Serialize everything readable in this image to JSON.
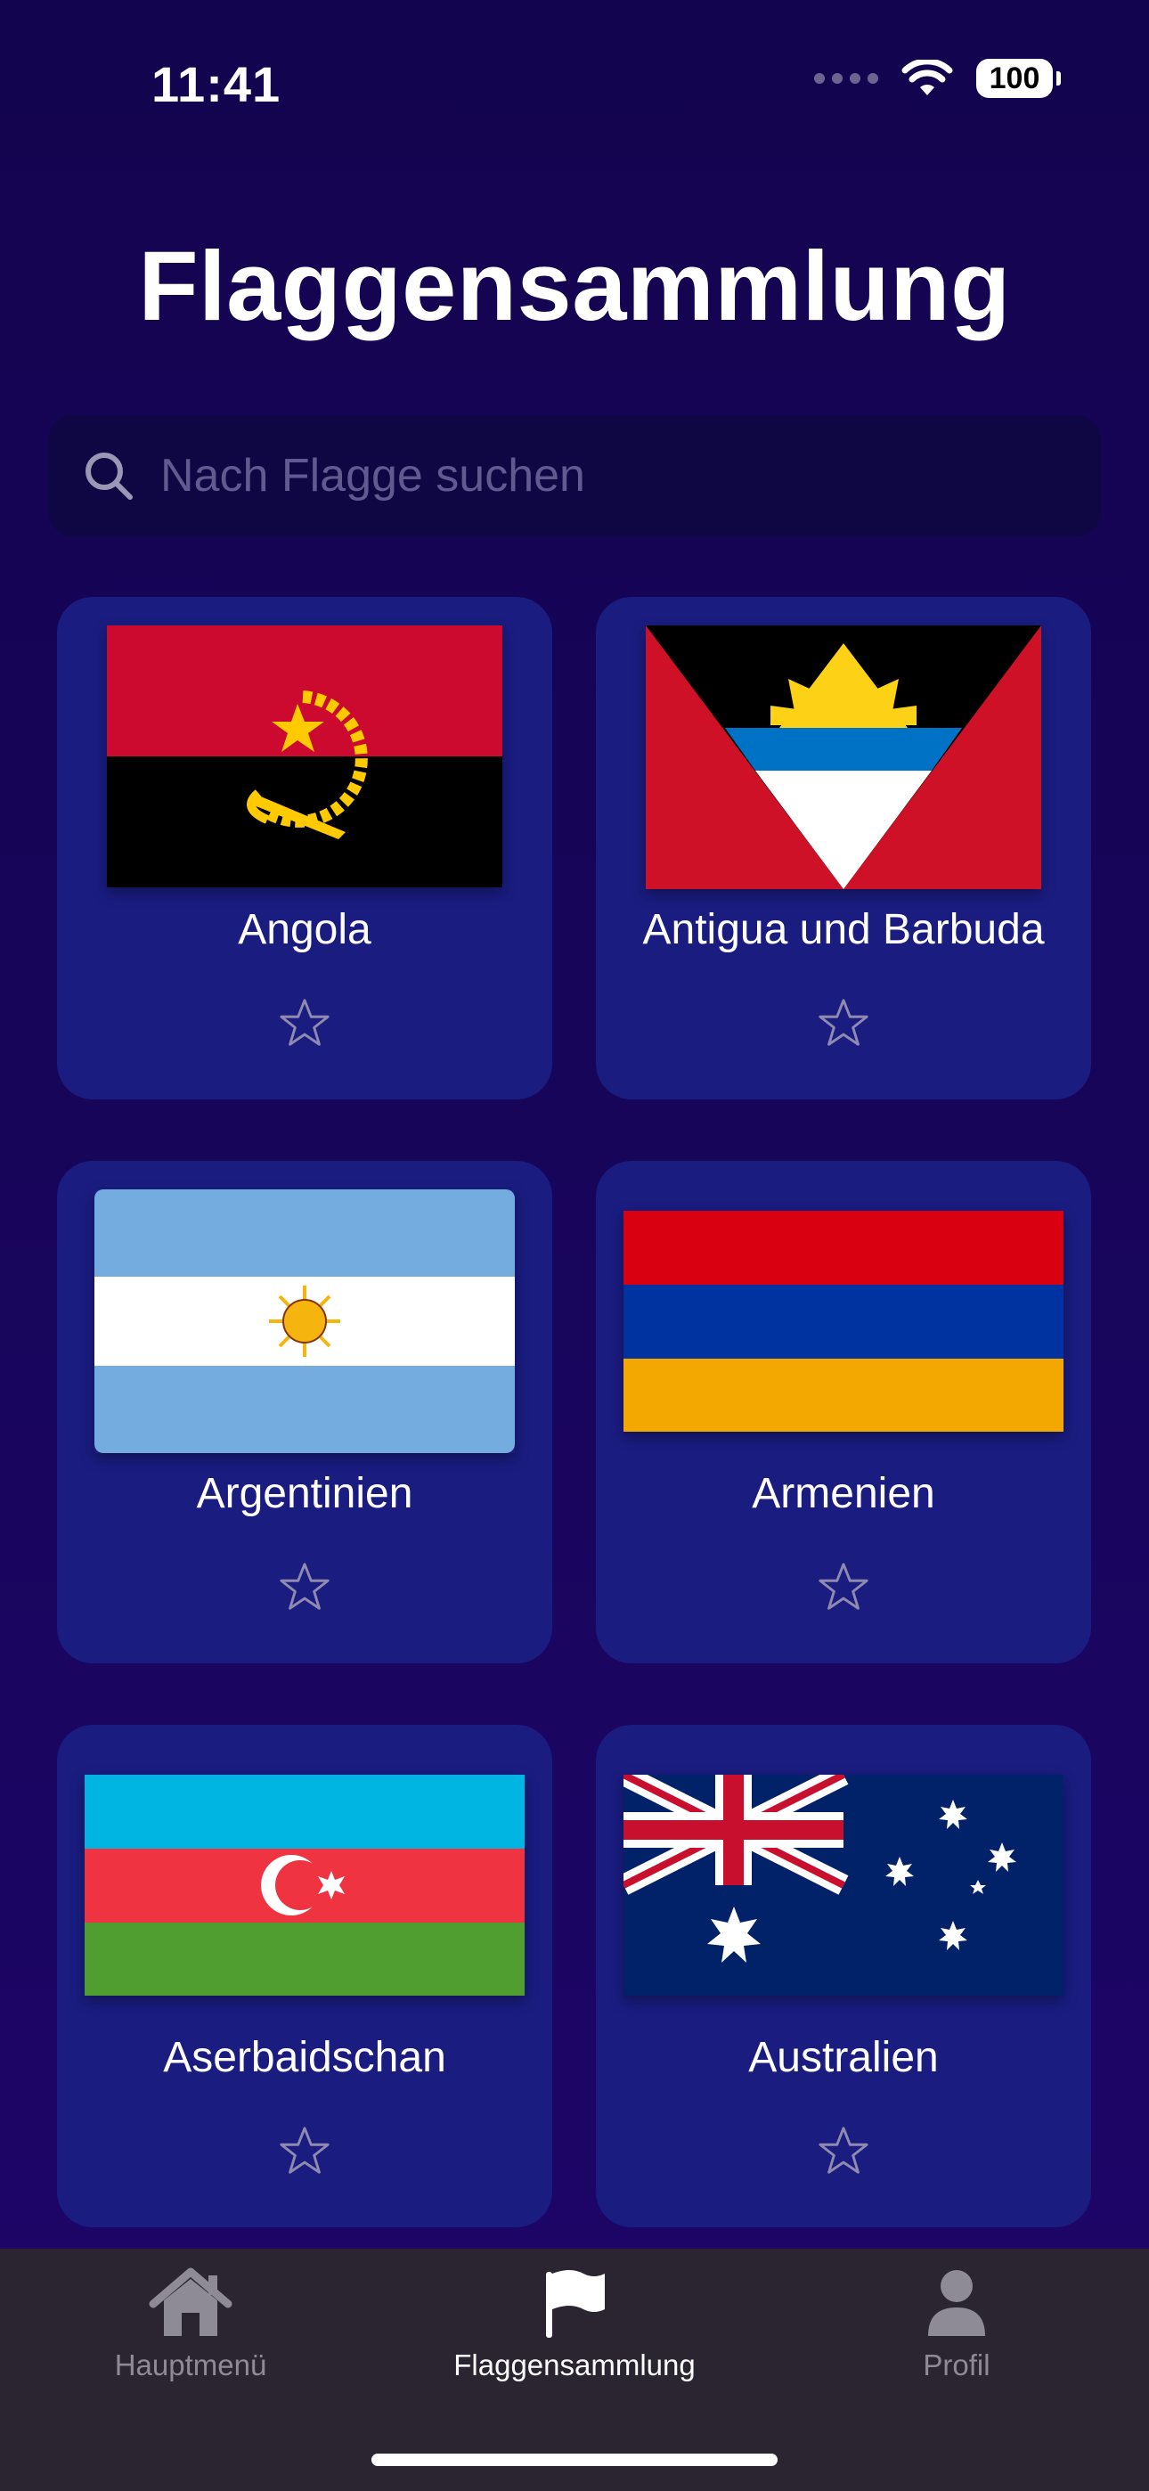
{
  "status_bar": {
    "time": "11:41",
    "battery": "100"
  },
  "header": {
    "title": "Flaggensammlung"
  },
  "search": {
    "placeholder": "Nach Flagge suchen",
    "value": ""
  },
  "flags": [
    {
      "name": "Angola",
      "favorite": false,
      "flag_icon": "flag-angola"
    },
    {
      "name": "Antigua und Barbuda",
      "favorite": false,
      "flag_icon": "flag-antigua-barbuda"
    },
    {
      "name": "Argentinien",
      "favorite": false,
      "flag_icon": "flag-argentina"
    },
    {
      "name": "Armenien",
      "favorite": false,
      "flag_icon": "flag-armenia"
    },
    {
      "name": "Aserbaidschan",
      "favorite": false,
      "flag_icon": "flag-azerbaijan"
    },
    {
      "name": "Australien",
      "favorite": false,
      "flag_icon": "flag-australia"
    }
  ],
  "tabbar": {
    "tabs": [
      {
        "label": "Hauptmenü",
        "icon": "house-icon",
        "active": false
      },
      {
        "label": "Flaggensammlung",
        "icon": "flag-icon",
        "active": true
      },
      {
        "label": "Profil",
        "icon": "person-icon",
        "active": false
      }
    ]
  },
  "colors": {
    "background": "#13044f",
    "card": "#1a1c80",
    "search_bg": "#0f0644",
    "tabbar_bg": "#2a2530",
    "tab_inactive": "#8e8a96"
  }
}
